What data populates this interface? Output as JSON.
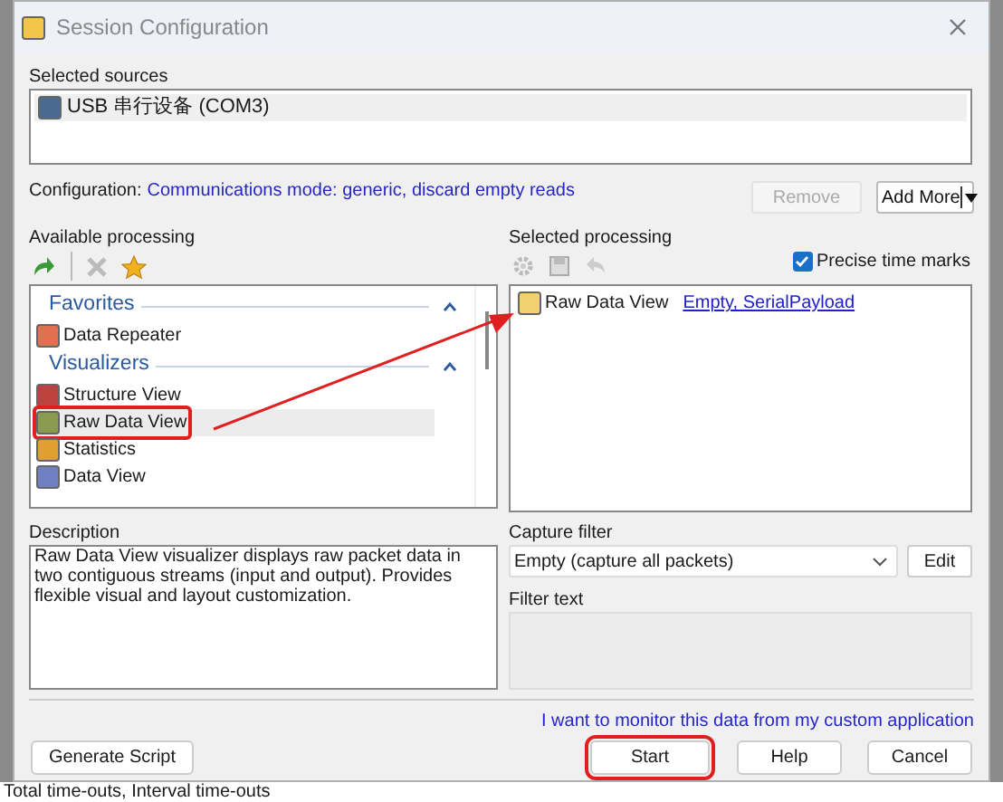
{
  "window": {
    "title": "Session Configuration"
  },
  "selected_sources": {
    "label": "Selected sources",
    "items": [
      {
        "label": "USB 串行设备 (COM3)",
        "selected": true
      }
    ]
  },
  "configuration": {
    "label": "Configuration:",
    "link": "Communications mode: generic, discard empty reads"
  },
  "source_buttons": [
    {
      "label": "Remove",
      "disabled": true
    },
    {
      "label": "Add More",
      "disabled": false
    }
  ],
  "available": {
    "label": "Available processing",
    "groups": [
      {
        "title": "Favorites",
        "expanded": true,
        "items": [
          {
            "label": "Data Repeater",
            "selected": false
          }
        ]
      },
      {
        "title": "Visualizers",
        "expanded": true,
        "items": [
          {
            "label": "Structure View",
            "selected": false
          },
          {
            "label": "Raw Data View",
            "selected": true
          },
          {
            "label": "Statistics",
            "selected": false
          },
          {
            "label": "Data View",
            "selected": false
          }
        ]
      }
    ]
  },
  "selected_processing": {
    "label": "Selected processing",
    "precise_time_marks": {
      "label": "Precise time marks",
      "checked": true
    },
    "items": [
      {
        "label": "Raw Data View",
        "link": "Empty, SerialPayload"
      }
    ]
  },
  "description": {
    "label": "Description",
    "text": "Raw Data View visualizer displays raw packet data in two contiguous streams (input and output). Provides flexible visual and layout customization."
  },
  "capture_filter": {
    "label": "Capture filter",
    "value": "Empty (capture all packets)",
    "edit": "Edit",
    "filter_text_label": "Filter text"
  },
  "custom_app_link": "I want to monitor this data from my custom application",
  "buttons": [
    {
      "label": "Generate Script",
      "kind": "left"
    },
    {
      "label": "Start",
      "kind": "default"
    },
    {
      "label": "Help",
      "kind": "normal"
    },
    {
      "label": "Cancel",
      "kind": "normal"
    }
  ],
  "background_text": "Total time-outs, Interval time-outs"
}
